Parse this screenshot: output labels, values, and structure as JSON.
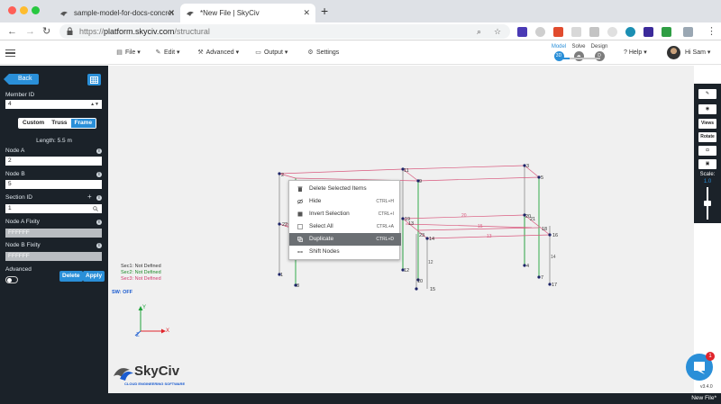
{
  "browser": {
    "tabs": [
      {
        "title": "sample-model-for-docs-concret",
        "active": false
      },
      {
        "title": "*New File | SkyCiv",
        "active": true
      }
    ],
    "new_tab_glyph": "+",
    "url_prefix": "https://",
    "url_host": "platform.skyciv.com",
    "url_path": "/structural",
    "traffic_colors": [
      "#ff5f57",
      "#febc2e",
      "#28c840"
    ]
  },
  "header": {
    "menus": [
      {
        "label": "File",
        "icon": "file-icon"
      },
      {
        "label": "Edit",
        "icon": "pencil-icon"
      },
      {
        "label": "Advanced",
        "icon": "wrench-icon"
      },
      {
        "label": "Output",
        "icon": "monitor-icon"
      },
      {
        "label": "Settings",
        "icon": "gear-icon"
      }
    ],
    "modes": [
      {
        "label": "Model",
        "badge": "3D",
        "active": true
      },
      {
        "label": "Solve",
        "badge": "",
        "active": false
      },
      {
        "label": "Design",
        "badge": "D",
        "active": false
      }
    ],
    "help_label": "Help",
    "user_label": "Hi Sam"
  },
  "sidebar": {
    "back_label": "Back",
    "member_id_label": "Member ID",
    "member_id_value": "4",
    "type_tabs": [
      {
        "label": "Custom",
        "active": false
      },
      {
        "label": "Truss",
        "active": false
      },
      {
        "label": "Frame",
        "active": true
      }
    ],
    "length_text": "Length: 5.5 m",
    "node_a_label": "Node A",
    "node_a_value": "2",
    "node_b_label": "Node B",
    "node_b_value": "5",
    "section_id_label": "Section ID",
    "section_id_value": "1",
    "node_a_fixity_label": "Node A Fixity",
    "node_a_fixity_value": "FFFFFF",
    "node_b_fixity_label": "Node B Fixity",
    "node_b_fixity_value": "FFFFFF",
    "advanced_label": "Advanced",
    "delete_label": "Delete",
    "apply_label": "Apply"
  },
  "canvas": {
    "sections": [
      {
        "text": "Sec1: Not Defined",
        "color": "#333333"
      },
      {
        "text": "Sec2: Not Defined",
        "color": "#1f8a2a"
      },
      {
        "text": "Sec3: Not Defined",
        "color": "#d23a6e"
      }
    ],
    "sw_label": "SW: OFF",
    "axis_labels": {
      "x": "X",
      "y": "Y",
      "z": "Z"
    },
    "logo_text": "SkyCiv",
    "logo_sub": "CLOUD ENGINEERING SOFTWARE",
    "node_labels": [
      "1",
      "2",
      "3",
      "4",
      "5",
      "6",
      "7",
      "8",
      "9",
      "10",
      "11",
      "12",
      "13",
      "14",
      "15",
      "16",
      "17",
      "18",
      "19",
      "20",
      "21",
      "22",
      "23"
    ],
    "member_labels": [
      "12",
      "13",
      "14",
      "15",
      "19",
      "20"
    ]
  },
  "context_menu": {
    "items": [
      {
        "label": "Delete Selected Items",
        "shortcut": "",
        "icon": "trash-icon",
        "highlight": false
      },
      {
        "label": "Hide",
        "shortcut": "CTRL+H",
        "icon": "eye-off-icon",
        "highlight": false
      },
      {
        "label": "Invert Selection",
        "shortcut": "CTRL+I",
        "icon": "invert-icon",
        "highlight": false
      },
      {
        "label": "Select All",
        "shortcut": "CTRL+A",
        "icon": "checkbox-icon",
        "highlight": false
      },
      {
        "label": "Duplicate",
        "shortcut": "CTRL+D",
        "icon": "copy-icon",
        "highlight": true
      },
      {
        "label": "Shift Nodes",
        "shortcut": "",
        "icon": "arrows-icon",
        "highlight": false
      }
    ]
  },
  "right_toolbar": {
    "views_label": "Views",
    "rotate_label": "Rotate",
    "scale_label": "Scale:",
    "scale_value": "1.0"
  },
  "chat_badge": "1",
  "version": "v3.4.0",
  "footer_filename": "New File*"
}
